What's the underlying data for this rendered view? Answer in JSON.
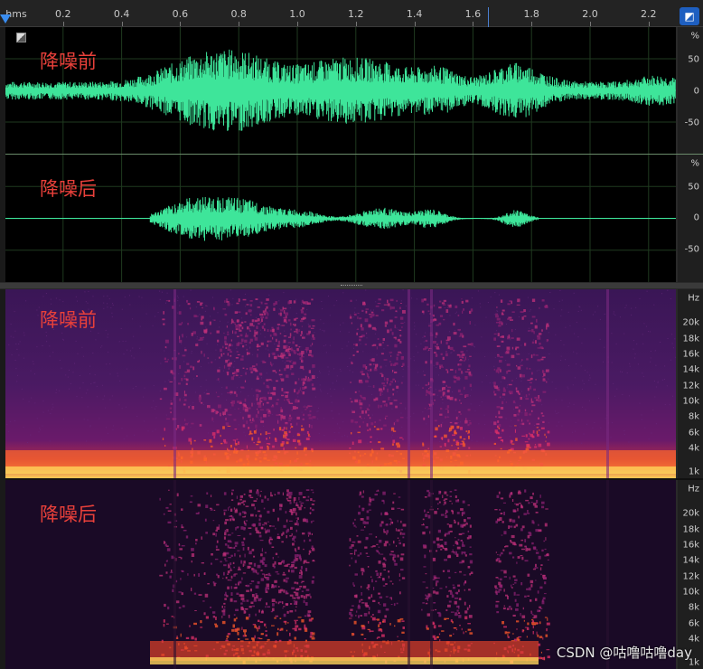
{
  "ruler": {
    "unit_label": "hms",
    "ticks": [
      "0.2",
      "0.4",
      "0.6",
      "0.8",
      "1.0",
      "1.2",
      "1.4",
      "1.6",
      "1.8",
      "2.0",
      "2.2"
    ]
  },
  "waveform": {
    "before_label": "降噪前",
    "after_label": "降噪后",
    "scale": {
      "unit": "%",
      "values": [
        "50",
        "0",
        "-50"
      ]
    },
    "color": "#3ee59a"
  },
  "spectrogram": {
    "before_label": "降噪前",
    "after_label": "降噪后",
    "scale": {
      "unit": "Hz",
      "values": [
        "20k",
        "18k",
        "16k",
        "14k",
        "12k",
        "10k",
        "8k",
        "6k",
        "4k",
        "1k"
      ]
    }
  },
  "watermark": "CSDN @咕噜咕噜day",
  "icons": [
    "playhead-marker-icon",
    "headphone-icon",
    "corner-toggle-icon"
  ]
}
